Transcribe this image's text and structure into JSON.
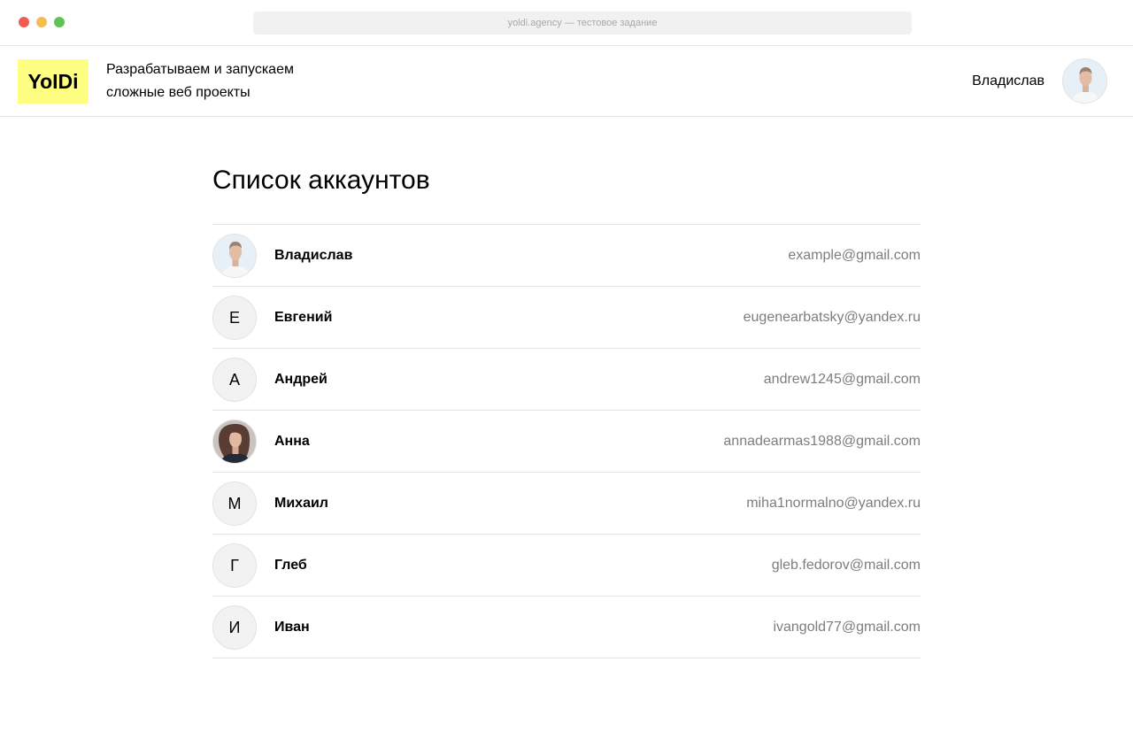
{
  "browser": {
    "url": "yoldi.agency — тестовое задание"
  },
  "header": {
    "logo_text": "YoIDi",
    "tagline_line1": "Разрабатываем и запускаем",
    "tagline_line2": "сложные веб проекты",
    "user_name": "Владислав",
    "user_avatar_icon": "male-portrait-photo"
  },
  "main": {
    "title": "Список аккаунтов",
    "accounts": [
      {
        "name": "Владислав",
        "email": "example@gmail.com",
        "avatar_type": "photo",
        "avatar_icon": "male-portrait-photo"
      },
      {
        "name": "Евгений",
        "email": "eugenearbatsky@yandex.ru",
        "avatar_type": "initial",
        "initial": "Е"
      },
      {
        "name": "Андрей",
        "email": "andrew1245@gmail.com",
        "avatar_type": "initial",
        "initial": "А"
      },
      {
        "name": "Анна",
        "email": "annadearmas1988@gmail.com",
        "avatar_type": "photo",
        "avatar_icon": "female-portrait-photo"
      },
      {
        "name": "Михаил",
        "email": "miha1normalno@yandex.ru",
        "avatar_type": "initial",
        "initial": "М"
      },
      {
        "name": "Глеб",
        "email": "gleb.fedorov@mail.com",
        "avatar_type": "initial",
        "initial": "Г"
      },
      {
        "name": "Иван",
        "email": "ivangold77@gmail.com",
        "avatar_type": "initial",
        "initial": "И"
      }
    ]
  },
  "colors": {
    "logo_background": "#fefe80",
    "email_text": "#7d7d7d",
    "divider": "#e3e3e3",
    "avatar_background": "#f2f2f2"
  }
}
